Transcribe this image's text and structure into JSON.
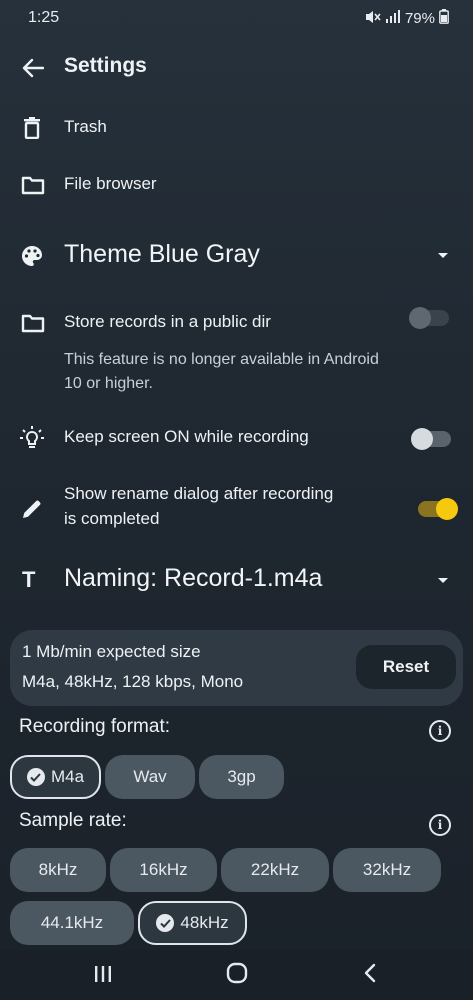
{
  "status_bar": {
    "time": "1:25",
    "battery": "79%"
  },
  "header": {
    "title": "Settings"
  },
  "menu": {
    "trash": "Trash",
    "file_browser": "File browser"
  },
  "theme": {
    "label": "Theme Blue Gray"
  },
  "settings": {
    "public_dir": {
      "label": "Store records in a public dir",
      "description_line1": "This feature is no longer available in Android",
      "description_line2": "10 or higher.",
      "enabled": false
    },
    "keep_screen_on": {
      "label": "Keep screen ON while recording",
      "enabled": false
    },
    "rename_dialog": {
      "label_line1": "Show rename dialog after recording",
      "label_line2": "is completed",
      "enabled": true
    }
  },
  "naming": {
    "label": "Naming: Record-1.m4a"
  },
  "info_card": {
    "expected_size": "1 Mb/min expected size",
    "format_summary": "M4a, 48kHz, 128 kbps, Mono",
    "reset_label": "Reset"
  },
  "recording_format": {
    "label": "Recording format:",
    "options": [
      "M4a",
      "Wav",
      "3gp"
    ],
    "selected": "M4a"
  },
  "sample_rate": {
    "label": "Sample rate:",
    "options": [
      "8kHz",
      "16kHz",
      "22kHz",
      "32kHz",
      "44.1kHz",
      "48kHz"
    ],
    "selected": "48kHz"
  },
  "colors": {
    "accent": "#f6c90e",
    "background": "#1f2730",
    "chip": "#4b5761"
  }
}
